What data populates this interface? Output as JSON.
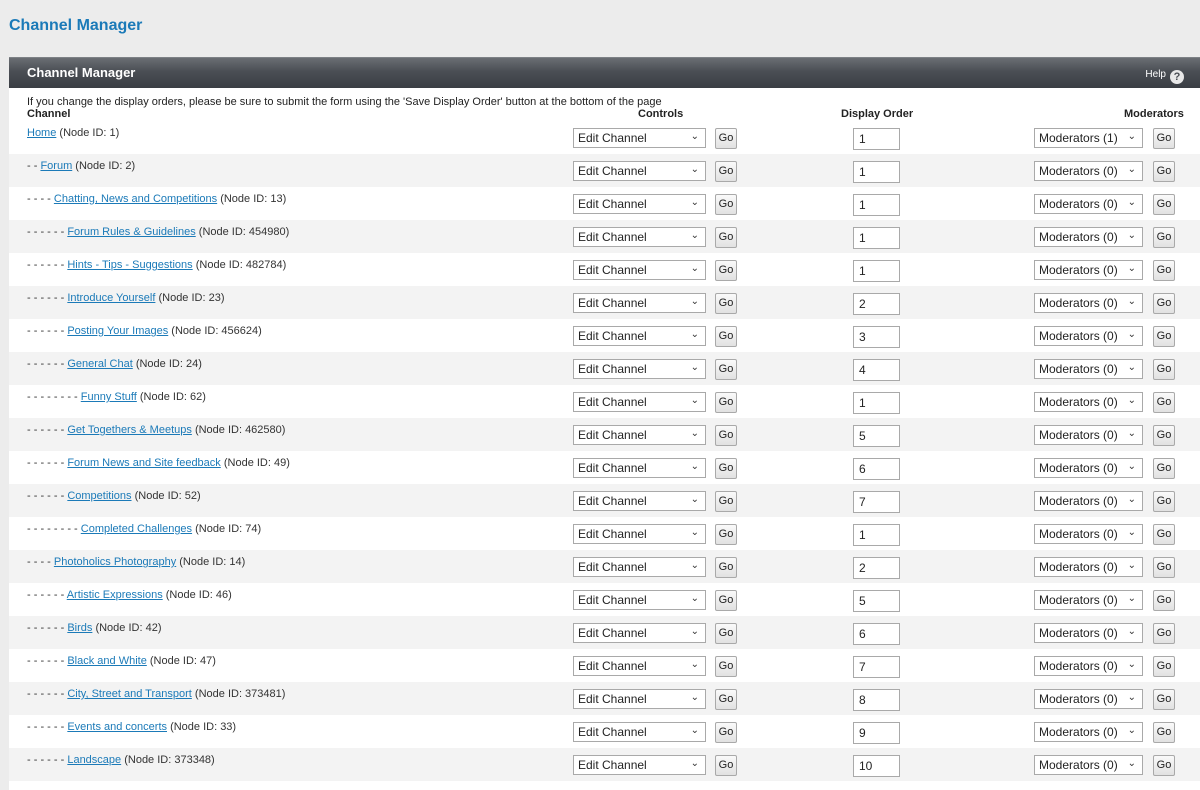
{
  "page": {
    "title": "Channel Manager"
  },
  "panel": {
    "title": "Channel Manager",
    "help_label": "Help",
    "help_icon": "question-circle-icon"
  },
  "note": "If you change the display orders, please be sure to submit the form using the 'Save Display Order' button at the bottom of the page",
  "columns": {
    "channel": "Channel",
    "controls": "Controls",
    "display_order": "Display Order",
    "moderators": "Moderators"
  },
  "rows": [
    {
      "prefix": "",
      "name": "Home",
      "node": "(Node ID: 1)",
      "control": "Edit Channel",
      "go": "Go",
      "order": "1",
      "moderators": "Moderators (1)"
    },
    {
      "prefix": "- -",
      "name": "Forum",
      "node": "(Node ID: 2)",
      "control": "Edit Channel",
      "go": "Go",
      "order": "1",
      "moderators": "Moderators (0)"
    },
    {
      "prefix": "- - - -",
      "name": "Chatting, News and Competitions",
      "node": "(Node ID: 13)",
      "control": "Edit Channel",
      "go": "Go",
      "order": "1",
      "moderators": "Moderators (0)"
    },
    {
      "prefix": "- - - - - -",
      "name": "Forum Rules & Guidelines",
      "node": "(Node ID: 454980)",
      "control": "Edit Channel",
      "go": "Go",
      "order": "1",
      "moderators": "Moderators (0)"
    },
    {
      "prefix": "- - - - - -",
      "name": "Hints - Tips - Suggestions",
      "node": "(Node ID: 482784)",
      "control": "Edit Channel",
      "go": "Go",
      "order": "1",
      "moderators": "Moderators (0)"
    },
    {
      "prefix": "- - - - - -",
      "name": "Introduce Yourself",
      "node": "(Node ID: 23)",
      "control": "Edit Channel",
      "go": "Go",
      "order": "2",
      "moderators": "Moderators (0)"
    },
    {
      "prefix": "- - - - - -",
      "name": "Posting Your Images",
      "node": "(Node ID: 456624)",
      "control": "Edit Channel",
      "go": "Go",
      "order": "3",
      "moderators": "Moderators (0)"
    },
    {
      "prefix": "- - - - - -",
      "name": "General Chat",
      "node": "(Node ID: 24)",
      "control": "Edit Channel",
      "go": "Go",
      "order": "4",
      "moderators": "Moderators (0)"
    },
    {
      "prefix": "- - - - - - - -",
      "name": "Funny Stuff",
      "node": "(Node ID: 62)",
      "control": "Edit Channel",
      "go": "Go",
      "order": "1",
      "moderators": "Moderators (0)"
    },
    {
      "prefix": "- - - - - -",
      "name": "Get Togethers & Meetups",
      "node": "(Node ID: 462580)",
      "control": "Edit Channel",
      "go": "Go",
      "order": "5",
      "moderators": "Moderators (0)"
    },
    {
      "prefix": "- - - - - -",
      "name": "Forum News and Site feedback",
      "node": "(Node ID: 49)",
      "control": "Edit Channel",
      "go": "Go",
      "order": "6",
      "moderators": "Moderators (0)"
    },
    {
      "prefix": "- - - - - -",
      "name": "Competitions",
      "node": "(Node ID: 52)",
      "control": "Edit Channel",
      "go": "Go",
      "order": "7",
      "moderators": "Moderators (0)"
    },
    {
      "prefix": "- - - - - - - -",
      "name": "Completed Challenges",
      "node": "(Node ID: 74)",
      "control": "Edit Channel",
      "go": "Go",
      "order": "1",
      "moderators": "Moderators (0)"
    },
    {
      "prefix": "- - - -",
      "name": "Photoholics Photography",
      "node": "(Node ID: 14)",
      "control": "Edit Channel",
      "go": "Go",
      "order": "2",
      "moderators": "Moderators (0)"
    },
    {
      "prefix": "- - - - - -",
      "name": "Artistic Expressions",
      "node": "(Node ID: 46)",
      "control": "Edit Channel",
      "go": "Go",
      "order": "5",
      "moderators": "Moderators (0)"
    },
    {
      "prefix": "- - - - - -",
      "name": "Birds",
      "node": "(Node ID: 42)",
      "control": "Edit Channel",
      "go": "Go",
      "order": "6",
      "moderators": "Moderators (0)"
    },
    {
      "prefix": "- - - - - -",
      "name": "Black and White",
      "node": "(Node ID: 47)",
      "control": "Edit Channel",
      "go": "Go",
      "order": "7",
      "moderators": "Moderators (0)"
    },
    {
      "prefix": "- - - - - -",
      "name": "City, Street and Transport",
      "node": "(Node ID: 373481)",
      "control": "Edit Channel",
      "go": "Go",
      "order": "8",
      "moderators": "Moderators (0)"
    },
    {
      "prefix": "- - - - - -",
      "name": "Events and concerts",
      "node": "(Node ID: 33)",
      "control": "Edit Channel",
      "go": "Go",
      "order": "9",
      "moderators": "Moderators (0)"
    },
    {
      "prefix": "- - - - - -",
      "name": "Landscape",
      "node": "(Node ID: 373348)",
      "control": "Edit Channel",
      "go": "Go",
      "order": "10",
      "moderators": "Moderators (0)"
    }
  ]
}
